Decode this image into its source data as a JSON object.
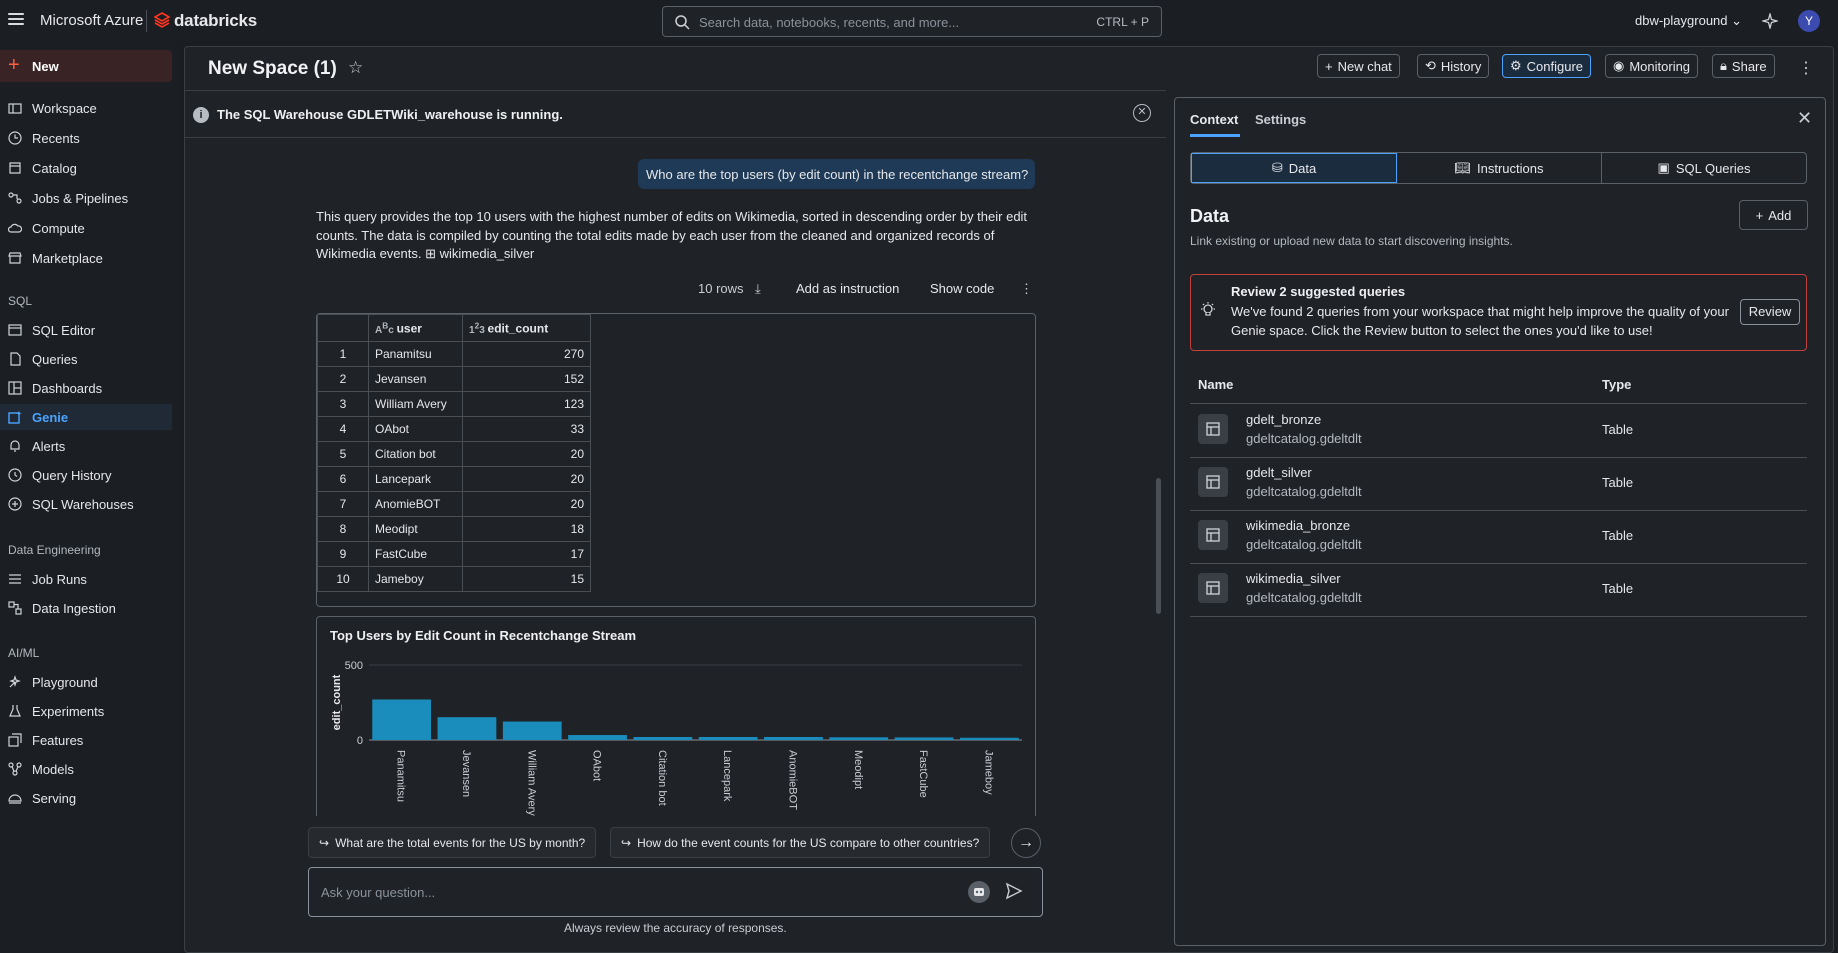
{
  "topbar": {
    "brand": "Microsoft Azure",
    "product": "databricks",
    "search_placeholder": "Search data, notebooks, recents, and more...",
    "search_shortcut": "CTRL + P",
    "workspace": "dbw-playground",
    "avatar_initial": "Y"
  },
  "sidebar": {
    "new_label": "New",
    "items_top": [
      "Workspace",
      "Recents",
      "Catalog",
      "Jobs & Pipelines",
      "Compute",
      "Marketplace"
    ],
    "sql_header": "SQL",
    "items_sql": [
      "SQL Editor",
      "Queries",
      "Dashboards",
      "Genie",
      "Alerts",
      "Query History",
      "SQL Warehouses"
    ],
    "de_header": "Data Engineering",
    "items_de": [
      "Job Runs",
      "Data Ingestion"
    ],
    "ai_header": "AI/ML",
    "items_ai": [
      "Playground",
      "Experiments",
      "Features",
      "Models",
      "Serving"
    ],
    "active": "Genie"
  },
  "header": {
    "title": "New Space (1)",
    "buttons": [
      "New chat",
      "History",
      "Configure",
      "Monitoring",
      "Share"
    ]
  },
  "banner": {
    "text": "The SQL Warehouse GDLETWiki_warehouse is running."
  },
  "chat": {
    "question": "Who are the top users (by edit count) in the recentchange stream?",
    "answer": "This query provides the top 10 users with the highest number of edits on Wikimedia, sorted in descending order by their edit counts. The data is compiled by counting the total edits made by each user from the cleaned and organized records of Wikimedia events.",
    "table_ref": "wikimedia_silver",
    "rows_label": "10 rows",
    "add_instruction": "Add as instruction",
    "show_code": "Show code",
    "columns": [
      "user",
      "edit_count"
    ],
    "rows": [
      [
        "1",
        "Panamitsu",
        "270"
      ],
      [
        "2",
        "Jevansen",
        "152"
      ],
      [
        "3",
        "William Avery",
        "123"
      ],
      [
        "4",
        "OAbot",
        "33"
      ],
      [
        "5",
        "Citation bot",
        "20"
      ],
      [
        "6",
        "Lancepark",
        "20"
      ],
      [
        "7",
        "AnomieBOT",
        "20"
      ],
      [
        "8",
        "Meodipt",
        "18"
      ],
      [
        "9",
        "FastCube",
        "17"
      ],
      [
        "10",
        "Jameboy",
        "15"
      ]
    ],
    "suggestions": [
      "What are the total events for the US by month?",
      "How do the event counts for the US compare to other countries?"
    ],
    "input_placeholder": "Ask your question...",
    "disclaimer": "Always review the accuracy of responses."
  },
  "chart_data": {
    "type": "bar",
    "title": "Top Users by Edit Count in Recentchange Stream",
    "xlabel": "",
    "ylabel": "edit_count",
    "categories": [
      "Panamitsu",
      "Jevansen",
      "William Avery",
      "OAbot",
      "Citation bot",
      "Lancepark",
      "AnomieBOT",
      "Meodipt",
      "FastCube",
      "Jameboy"
    ],
    "values": [
      270,
      152,
      123,
      33,
      20,
      20,
      20,
      18,
      17,
      15
    ],
    "yticks": [
      "0",
      "500"
    ],
    "ylim": [
      0,
      500
    ],
    "color": "#1a8dbd"
  },
  "panel": {
    "tabs": [
      "Context",
      "Settings"
    ],
    "segments": [
      "Data",
      "Instructions",
      "SQL Queries"
    ],
    "heading": "Data",
    "subheading": "Link existing or upload new data to start discovering insights.",
    "add_label": "Add",
    "review_title": "Review 2 suggested queries",
    "review_desc": "We've found 2 queries from your workspace that might help improve the quality of your Genie space. Click the Review button to select the ones you'd like to use!",
    "review_button": "Review",
    "col_name": "Name",
    "col_type": "Type",
    "tables": [
      {
        "name": "gdelt_bronze",
        "schema": "gdeltcatalog.gdeltdlt",
        "type": "Table"
      },
      {
        "name": "gdelt_silver",
        "schema": "gdeltcatalog.gdeltdlt",
        "type": "Table"
      },
      {
        "name": "wikimedia_bronze",
        "schema": "gdeltcatalog.gdeltdlt",
        "type": "Table"
      },
      {
        "name": "wikimedia_silver",
        "schema": "gdeltcatalog.gdeltdlt",
        "type": "Table"
      }
    ]
  }
}
